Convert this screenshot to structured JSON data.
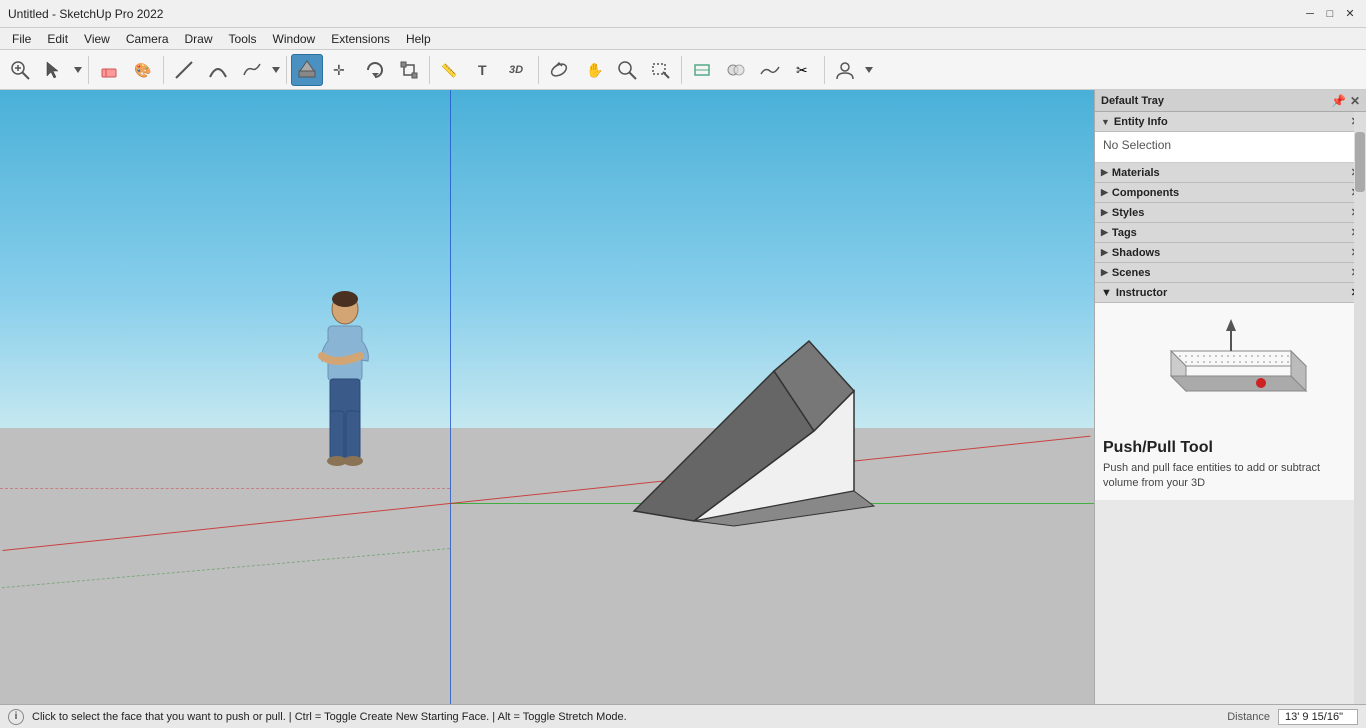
{
  "window": {
    "title": "Untitled - SketchUp Pro 2022"
  },
  "titlebar": {
    "title": "Untitled - SketchUp Pro 2022",
    "minimize": "─",
    "maximize": "□",
    "close": "✕"
  },
  "menubar": {
    "items": [
      "File",
      "Edit",
      "View",
      "Camera",
      "Draw",
      "Tools",
      "Window",
      "Extensions",
      "Help"
    ]
  },
  "toolbar": {
    "tools": [
      {
        "name": "zoom-extents",
        "icon": "🔍",
        "active": false
      },
      {
        "name": "select",
        "icon": "↖",
        "active": false
      },
      {
        "name": "eraser",
        "icon": "⬜",
        "active": false
      },
      {
        "name": "paint-bucket",
        "icon": "🖌",
        "active": false
      },
      {
        "name": "line",
        "icon": "/",
        "active": false
      },
      {
        "name": "arc",
        "icon": "◠",
        "active": false
      },
      {
        "name": "rectangle",
        "icon": "▭",
        "active": false
      },
      {
        "name": "circle",
        "icon": "○",
        "active": false
      },
      {
        "name": "push-pull",
        "icon": "⬆",
        "active": true
      },
      {
        "name": "move",
        "icon": "✛",
        "active": false
      },
      {
        "name": "rotate",
        "icon": "↻",
        "active": false
      },
      {
        "name": "scale",
        "icon": "⤡",
        "active": false
      },
      {
        "name": "tape-measure",
        "icon": "📏",
        "active": false
      },
      {
        "name": "text",
        "icon": "T",
        "active": false
      },
      {
        "name": "3d-text",
        "icon": "3T",
        "active": false
      },
      {
        "name": "orbit",
        "icon": "⟳",
        "active": false
      },
      {
        "name": "pan",
        "icon": "✋",
        "active": false
      },
      {
        "name": "zoom",
        "icon": "🔍",
        "active": false
      },
      {
        "name": "zoom-in-out",
        "icon": "⤢",
        "active": false
      },
      {
        "name": "section-plane",
        "icon": "⬡",
        "active": false
      },
      {
        "name": "solid-tools",
        "icon": "✦",
        "active": false
      },
      {
        "name": "sandbox",
        "icon": "≋",
        "active": false
      },
      {
        "name": "extension1",
        "icon": "✂",
        "active": false
      },
      {
        "name": "profile-builder",
        "icon": "👤",
        "active": false
      }
    ]
  },
  "right_panel": {
    "tray_title": "Default Tray",
    "sections": [
      {
        "name": "entity-info",
        "label": "Entity Info",
        "expanded": true,
        "content": "No Selection"
      },
      {
        "name": "materials",
        "label": "Materials",
        "expanded": false
      },
      {
        "name": "components",
        "label": "Components",
        "expanded": false
      },
      {
        "name": "styles",
        "label": "Styles",
        "expanded": false
      },
      {
        "name": "tags",
        "label": "Tags",
        "expanded": false
      },
      {
        "name": "shadows",
        "label": "Shadows",
        "expanded": false
      },
      {
        "name": "scenes",
        "label": "Scenes",
        "expanded": false
      },
      {
        "name": "instructor",
        "label": "Instructor",
        "expanded": true
      }
    ],
    "instructor": {
      "tool_name": "Push/Pull Tool",
      "description": "Push and pull face entities to add or subtract volume from your 3D"
    }
  },
  "statusbar": {
    "info": "i",
    "status_text": "Click to select the face that you want to push or pull. | Ctrl = Toggle Create New Starting Face. | Alt = Toggle Stretch Mode.",
    "distance_label": "Distance",
    "distance_value": "13' 9 15/16\""
  }
}
